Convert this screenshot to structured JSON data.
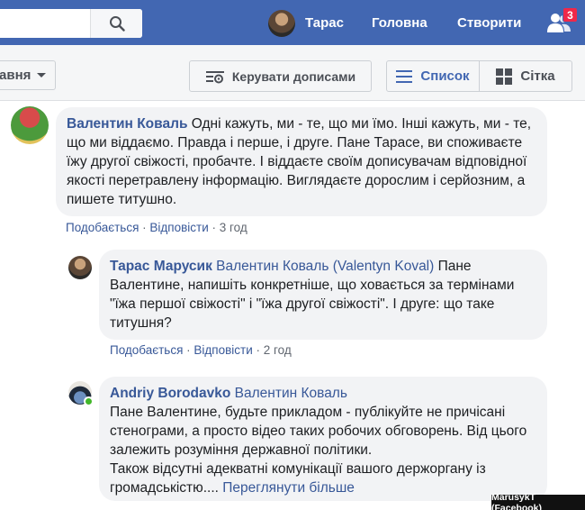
{
  "topbar": {
    "profile_name": "Тарас",
    "home_label": "Головна",
    "create_label": "Створити",
    "notifications_count": "3"
  },
  "toolbar": {
    "sort_label": "авня",
    "manage_posts_label": "Керувати дописами",
    "list_label": "Список",
    "grid_label": "Сітка"
  },
  "comments": [
    {
      "author": "Валентин Коваль",
      "text": " Одні кажуть, ми - те, що ми їмо. Інші кажуть, ми - те, що ми віддаємо. Правда і перше, і друге. Пане Тарасе, ви споживаєте їжу другої свіжості, пробачте. І віддаєте своїм дописувачам відповідної якості перетравлену інформацію. Виглядаєте дорослим і серйозним, а пишете титушно.",
      "like_label": "Подобається",
      "reply_label": "Відповісти",
      "time": "3 год"
    },
    {
      "author": "Тарас Марусик",
      "mention": "Валентин Коваль (Valentyn Koval)",
      "text": " Пане Валентине, напишіть конкретніше, що ховається за термінами \"їжа першої свіжості\" і \"їжа другої свіжості\". І друге: що таке титушня?",
      "like_label": "Подобається",
      "reply_label": "Відповісти",
      "time": "2 год"
    },
    {
      "author": "Andriy Borodavko",
      "mention": "Валентин Коваль",
      "text": "Пане Валентине, будьте прикладом - публікуйте не причісані стенограми, а просто відео таких робочих обговорень. Від цього залежить розуміння державної політики.",
      "text2": "Також відсутні адекватні комунікації вашого держоргану із громадськістю.... ",
      "see_more": "Переглянути більше"
    }
  ],
  "credit": "MarusykT (Facebook)"
}
